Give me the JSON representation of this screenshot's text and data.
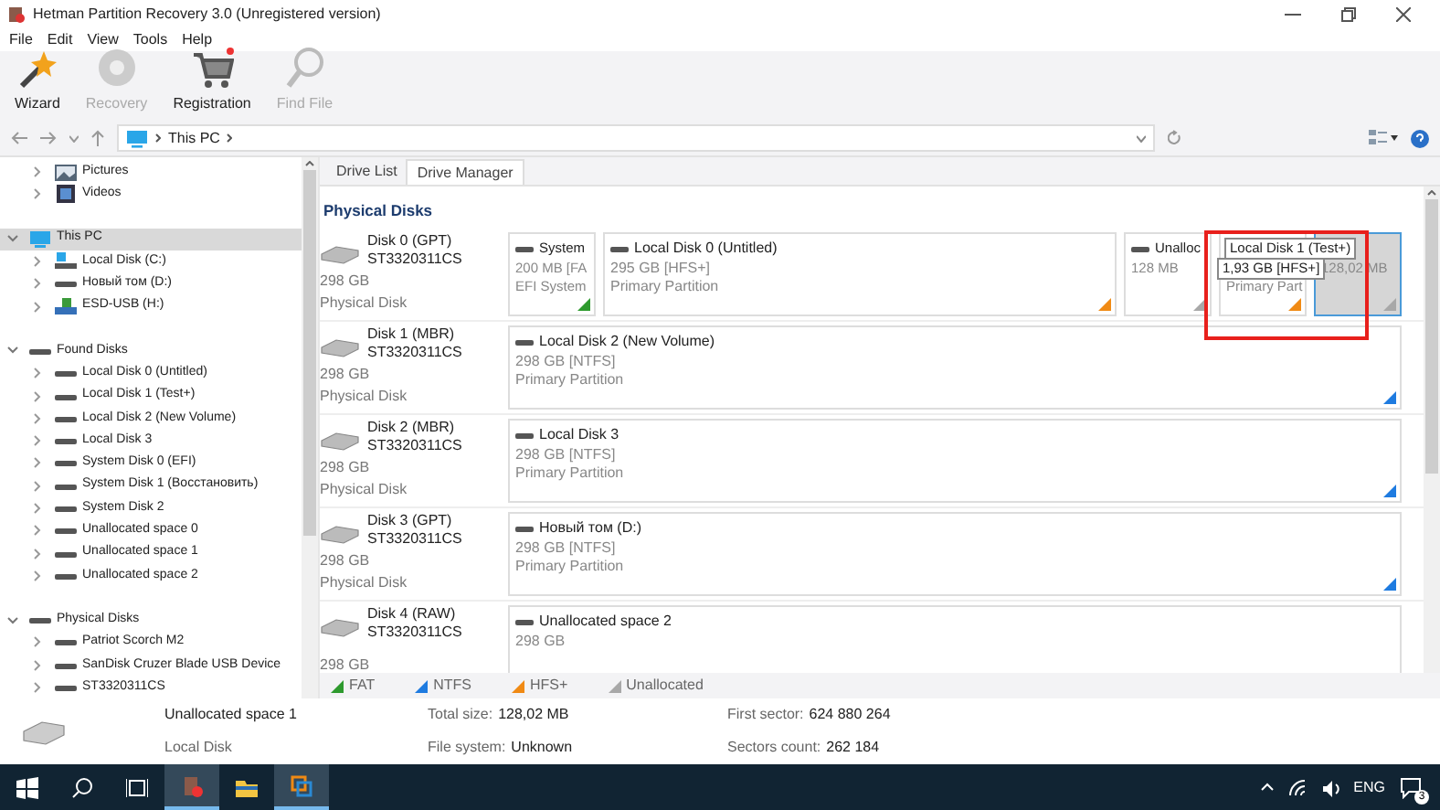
{
  "window": {
    "title": "Hetman Partition Recovery 3.0 (Unregistered version)"
  },
  "menu": [
    "File",
    "Edit",
    "View",
    "Tools",
    "Help"
  ],
  "toolbar": [
    {
      "label": "Wizard",
      "kind": "wizard",
      "disabled": false
    },
    {
      "label": "Recovery",
      "kind": "recovery",
      "disabled": true
    },
    {
      "label": "Registration",
      "kind": "cart",
      "disabled": false
    },
    {
      "label": "Find File",
      "kind": "find",
      "disabled": true
    }
  ],
  "address": {
    "path": "This PC"
  },
  "tree": [
    {
      "children": [
        {
          "label": "Pictures",
          "kind": "pictures",
          "expanded": false,
          "selected": false
        },
        {
          "label": "Videos",
          "kind": "videos",
          "expanded": false,
          "selected": false
        }
      ]
    },
    {
      "label": "This PC",
      "kind": "computer",
      "expanded": true,
      "selected": true,
      "children": [
        {
          "label": "Local Disk (C:)",
          "kind": "system",
          "expanded": false,
          "selected": false
        },
        {
          "label": "Новый том (D:)",
          "kind": "drive",
          "expanded": false,
          "selected": false
        },
        {
          "label": "ESD-USB (H:)",
          "kind": "usb",
          "expanded": false,
          "selected": false
        }
      ]
    },
    {
      "label": "Found Disks",
      "kind": "drive",
      "expanded": true,
      "selected": false,
      "children": [
        {
          "label": "Local Disk 0 (Untitled)",
          "kind": "drive",
          "expanded": false,
          "selected": false
        },
        {
          "label": "Local Disk 1 (Test+)",
          "kind": "drive",
          "expanded": false,
          "selected": false
        },
        {
          "label": "Local Disk 2 (New Volume)",
          "kind": "drive",
          "expanded": false,
          "selected": false
        },
        {
          "label": "Local Disk 3",
          "kind": "drive",
          "expanded": false,
          "selected": false
        },
        {
          "label": "System Disk 0 (EFI)",
          "kind": "drive",
          "expanded": false,
          "selected": false
        },
        {
          "label": "System Disk 1 (Восстановить)",
          "kind": "drive",
          "expanded": false,
          "selected": false
        },
        {
          "label": "System Disk 2",
          "kind": "drive",
          "expanded": false,
          "selected": false
        },
        {
          "label": "Unallocated space 0",
          "kind": "drive",
          "expanded": false,
          "selected": false
        },
        {
          "label": "Unallocated space 1",
          "kind": "drive",
          "expanded": false,
          "selected": false
        },
        {
          "label": "Unallocated space 2",
          "kind": "drive",
          "expanded": false,
          "selected": false
        }
      ]
    },
    {
      "label": "Physical Disks",
      "kind": "drive",
      "expanded": true,
      "selected": false,
      "children": [
        {
          "label": "Patriot Scorch M2",
          "kind": "drive",
          "expanded": false,
          "selected": false
        },
        {
          "label": "SanDisk Cruzer Blade USB Device",
          "kind": "drive",
          "expanded": false,
          "selected": false
        },
        {
          "label": "ST3320311CS",
          "kind": "drive",
          "expanded": false,
          "selected": false
        }
      ]
    }
  ],
  "tabs": [
    {
      "label": "Drive List",
      "selected": false
    },
    {
      "label": "Drive Manager",
      "selected": true
    }
  ],
  "section_title": "Physical Disks",
  "disks": [
    {
      "name": "Disk 0 (GPT)",
      "model": "ST3320311CS",
      "size": "298 GB",
      "type": "Physical Disk",
      "partitions": [
        {
          "name": "System",
          "lines": [
            "200 MB [FA",
            "EFI System"
          ],
          "color": "#2e9a2e",
          "compact": true,
          "selected": false
        },
        {
          "name": "Local Disk 0 (Untitled)",
          "lines": [
            "295 GB [HFS+]",
            "Primary Partition"
          ],
          "color": "#f08a14",
          "compact": false,
          "selected": false
        },
        {
          "name": "Unalloc",
          "lines": [
            "128 MB"
          ],
          "color": "#a8a8a8",
          "compact": true,
          "selected": false
        },
        {
          "lines": [
            "Primary Part"
          ],
          "color": "#f08a14",
          "compact": true,
          "selected": false,
          "tooltip": {
            "lines": [
              "Local Disk 1 (Test+)",
              "1,93 GB [HFS+]"
            ],
            "framed": true
          }
        },
        {
          "lines": [
            "128,02 MB"
          ],
          "color": "#a8a8a8",
          "compact": true,
          "selected": true
        }
      ]
    },
    {
      "name": "Disk 1 (MBR)",
      "model": "ST3320311CS",
      "size": "298 GB",
      "type": "Physical Disk",
      "partitions": [
        {
          "name": "Local Disk 2 (New Volume)",
          "lines": [
            "298 GB [NTFS]",
            "Primary Partition"
          ],
          "color": "#1e7be0",
          "compact": false,
          "selected": false
        }
      ]
    },
    {
      "name": "Disk 2 (MBR)",
      "model": "ST3320311CS",
      "size": "298 GB",
      "type": "Physical Disk",
      "partitions": [
        {
          "name": "Local Disk 3",
          "lines": [
            "298 GB [NTFS]",
            "Primary Partition"
          ],
          "color": "#1e7be0",
          "compact": false,
          "selected": false
        }
      ]
    },
    {
      "name": "Disk 3 (GPT)",
      "model": "ST3320311CS",
      "size": "298 GB",
      "type": "Physical Disk",
      "partitions": [
        {
          "name": "Новый том (D:)",
          "lines": [
            "298 GB [NTFS]",
            "Primary Partition"
          ],
          "color": "#1e7be0",
          "compact": false,
          "selected": false
        }
      ]
    },
    {
      "name": "Disk 4 (RAW)",
      "model": "ST3320311CS",
      "size": "298 GB",
      "partitions": [
        {
          "name": "Unallocated space 2",
          "lines": [
            "298 GB"
          ],
          "compact": false,
          "selected": false
        }
      ]
    }
  ],
  "legend": [
    {
      "label": "FAT",
      "color": "#2e9a2e"
    },
    {
      "label": "NTFS",
      "color": "#1e7be0"
    },
    {
      "label": "HFS+",
      "color": "#f08a14"
    },
    {
      "label": "Unallocated",
      "color": "#a8a8a8"
    }
  ],
  "details": {
    "name": "Unallocated space 1",
    "type": "Local Disk",
    "fields": [
      {
        "label": "Total size:",
        "value": "128,02 MB"
      },
      {
        "label": "File system:",
        "value": "Unknown"
      },
      {
        "label": "First sector:",
        "value": "624 880 264"
      },
      {
        "label": "Sectors count:",
        "value": "262 184"
      }
    ]
  },
  "taskbar": {
    "apps": [
      {
        "kind": "hetman",
        "active": true
      },
      {
        "kind": "folder",
        "active": false
      },
      {
        "kind": "vm",
        "active": true
      }
    ],
    "language": "ENG",
    "notifications": "3"
  }
}
